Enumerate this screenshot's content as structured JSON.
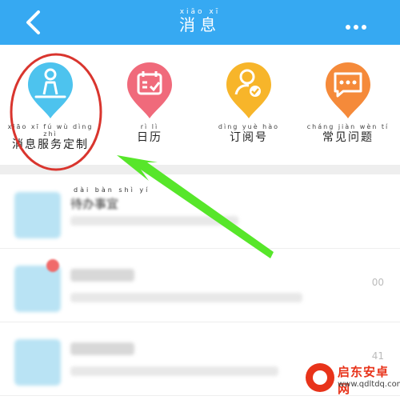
{
  "header": {
    "title": "消息",
    "title_ruby": "xiāo xī",
    "back_icon": "chevron-left-icon",
    "more_icon": "more-dots-icon",
    "color": "#36a9f2"
  },
  "entries": [
    {
      "label": "消息服务定制",
      "ruby": "xiāo xī fú wù dìng zhì",
      "icon": "person-meditate-icon",
      "color": "#4dc3ee"
    },
    {
      "label": "日历",
      "ruby": "rì lì",
      "icon": "calendar-check-icon",
      "color": "#f06a7b"
    },
    {
      "label": "订阅号",
      "ruby": "dìng yuè hào",
      "icon": "user-check-icon",
      "color": "#f7b52a"
    },
    {
      "label": "常见问题",
      "ruby": "cháng jiàn wèn tí",
      "icon": "chat-bubble-icon",
      "color": "#f58a3a"
    }
  ],
  "list": [
    {
      "title": "待办事宜",
      "ruby": "dài bàn shì yí",
      "time": "",
      "icon": "notice-icon"
    },
    {
      "title": "",
      "ruby": "",
      "time": "00",
      "icon": "notice-icon"
    },
    {
      "title": "",
      "ruby": "",
      "time": "41",
      "icon": "notice-icon"
    }
  ],
  "watermark": {
    "name": "启东安卓网",
    "url": "www.qdltdq.com"
  },
  "annotation": {
    "circle_color": "#d9352e",
    "arrow_color": "#57e62a"
  }
}
